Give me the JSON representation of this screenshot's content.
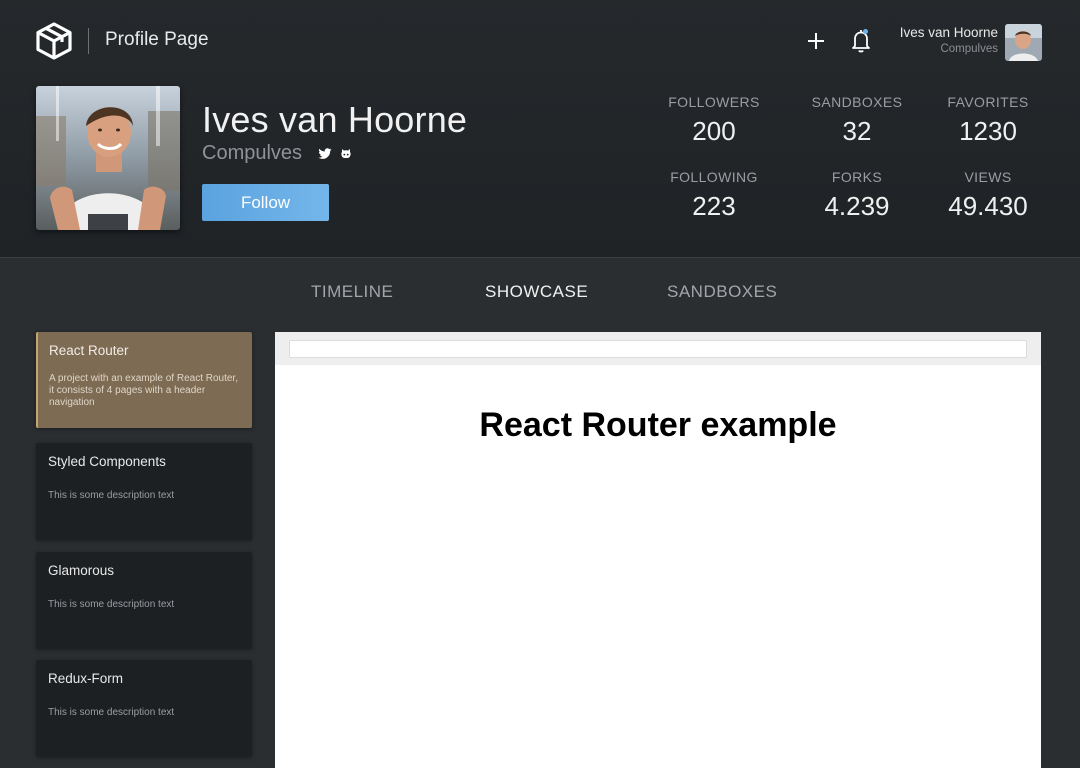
{
  "header": {
    "page_title": "Profile Page",
    "user": {
      "name": "Ives van Hoorne",
      "handle": "Compulves"
    },
    "icons": [
      "codesandbox-logo-icon",
      "plus-icon",
      "bell-icon"
    ]
  },
  "profile": {
    "name": "Ives van Hoorne",
    "handle": "Compulves",
    "follow_label": "Follow",
    "stats": [
      {
        "label": "FOLLOWERS",
        "value": "200"
      },
      {
        "label": "SANDBOXES",
        "value": "32"
      },
      {
        "label": "FAVORITES",
        "value": "1230"
      },
      {
        "label": "FOLLOWING",
        "value": "223"
      },
      {
        "label": "FORKS",
        "value": "4.239"
      },
      {
        "label": "VIEWS",
        "value": "49.430"
      }
    ]
  },
  "tabs": [
    {
      "label": "TIMELINE",
      "active": false
    },
    {
      "label": "SHOWCASE",
      "active": true
    },
    {
      "label": "SANDBOXES",
      "active": false
    }
  ],
  "sandboxes": [
    {
      "title": "React Router",
      "description": "A project with an example of React Router, it consists of 4 pages with a header navigation",
      "selected": true
    },
    {
      "title": "Styled Components",
      "description": "This is some description text",
      "selected": false
    },
    {
      "title": "Glamorous",
      "description": "This is some description text",
      "selected": false
    },
    {
      "title": "Redux-Form",
      "description": "This is some description text",
      "selected": false
    }
  ],
  "preview": {
    "heading": "React Router example"
  },
  "colors": {
    "accent": "#5aa3e0",
    "selected_card": "#7d6b54",
    "background": "#2a2e31"
  }
}
